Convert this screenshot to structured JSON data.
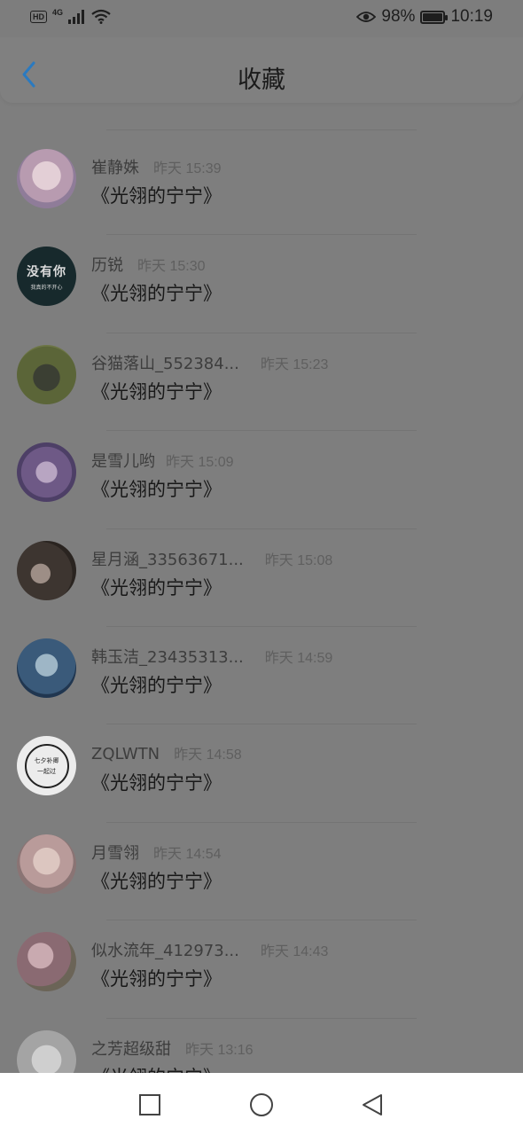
{
  "status_bar": {
    "hd": "HD",
    "network": "4G",
    "battery_percent": "98%",
    "battery_level": 0.98,
    "time": "10:19",
    "icons": [
      "hd-icon",
      "signal-icon",
      "wifi-icon",
      "eye-icon",
      "battery-icon"
    ]
  },
  "header": {
    "title": "收藏",
    "back_icon": "chevron-left-icon"
  },
  "items": [
    {
      "name": "崔静姝",
      "time": "昨天 15:39",
      "work": "《光翎的宁宁》"
    },
    {
      "name": "历锐",
      "time": "昨天 15:30",
      "work": "《光翎的宁宁》",
      "avatar_text": "没有你",
      "avatar_subtext": "我真的不开心"
    },
    {
      "name": "谷猫落山_552384...",
      "time": "昨天 15:23",
      "work": "《光翎的宁宁》"
    },
    {
      "name": "是雪儿哟",
      "time": "昨天 15:09",
      "work": "《光翎的宁宁》"
    },
    {
      "name": "星月涵_33563671...",
      "time": "昨天 15:08",
      "work": "《光翎的宁宁》"
    },
    {
      "name": "韩玉洁_23435313...",
      "time": "昨天 14:59",
      "work": "《光翎的宁宁》"
    },
    {
      "name": "ZQLWTN",
      "time": "昨天 14:58",
      "work": "《光翎的宁宁》",
      "avatar_text": "七夕补卿",
      "avatar_subtext": "一起过"
    },
    {
      "name": "月雪翎",
      "time": "昨天 14:54",
      "work": "《光翎的宁宁》"
    },
    {
      "name": "似水流年_412973...",
      "time": "昨天 14:43",
      "work": "《光翎的宁宁》"
    },
    {
      "name": "之芳超级甜",
      "time": "昨天 13:16",
      "work": "《光翎的宁宁》"
    }
  ],
  "nav": {
    "icons": [
      "recent-apps-icon",
      "home-icon",
      "back-icon"
    ]
  }
}
